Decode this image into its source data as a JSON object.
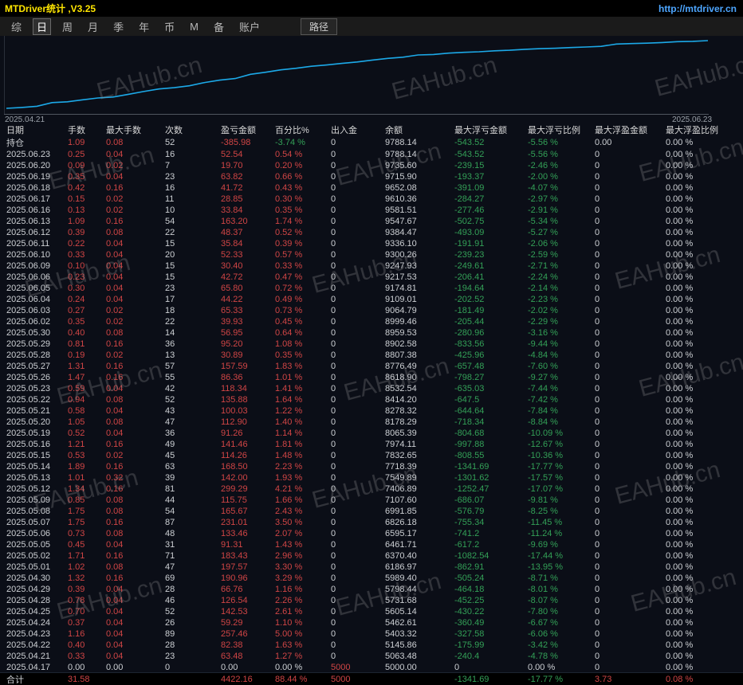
{
  "header": {
    "title": "MTDriver统计 ,V3.25",
    "url": "http://mtdriver.cn"
  },
  "menu": {
    "items": [
      "综",
      "日",
      "周",
      "月",
      "季",
      "年",
      "币",
      "M",
      "备",
      "账户"
    ],
    "selected_index": 1,
    "path_button": "路径"
  },
  "watermark": {
    "text": "EAHub.cn"
  },
  "colors": {
    "red": "#d04545",
    "green": "#33a057",
    "yellow": "#ffe600",
    "blue": "#4da6ff",
    "line": "#1ca9e8"
  },
  "chart_data": {
    "type": "line",
    "title": "",
    "series_name": "余额",
    "x_start_label": "2025.04.21",
    "x_end_label": "2025.06.23",
    "ylim": [
      5000,
      9800
    ],
    "grid": false,
    "balances": [
      5000.0,
      5063.48,
      5145.86,
      5403.32,
      5462.61,
      5605.14,
      5731.68,
      5798.44,
      5989.4,
      6186.97,
      6370.4,
      6461.71,
      6595.17,
      6826.18,
      6991.85,
      7107.6,
      7406.89,
      7549.89,
      7718.39,
      7832.65,
      7974.11,
      8065.39,
      8178.29,
      8278.32,
      8414.2,
      8532.54,
      8618.9,
      8776.49,
      8807.38,
      8902.58,
      8959.53,
      8999.46,
      9064.79,
      9109.01,
      9174.81,
      9217.53,
      9247.93,
      9300.26,
      9336.1,
      9384.47,
      9547.67,
      9581.51,
      9610.36,
      9652.08,
      9715.9,
      9735.6,
      9788.14
    ]
  },
  "table": {
    "columns": [
      "日期",
      "手数",
      "最大手数",
      "次数",
      "盈亏金额",
      "百分比%",
      "出入金",
      "余额",
      "最大浮亏金额",
      "最大浮亏比例",
      "最大浮盈金额",
      "最大浮盈比例"
    ],
    "rows": [
      [
        "持仓",
        "1.09",
        "0.08",
        "52",
        "-385.98",
        "-3.74 %",
        "0",
        "9788.14",
        "-543.52",
        "-5.56 %",
        "0.00",
        "0.00 %"
      ],
      [
        "2025.06.23",
        "0.25",
        "0.04",
        "16",
        "52.54",
        "0.54 %",
        "0",
        "9788.14",
        "-543.52",
        "-5.56 %",
        "0",
        "0.00 %"
      ],
      [
        "2025.06.20",
        "0.09",
        "0.02",
        "7",
        "19.70",
        "0.20 %",
        "0",
        "9735.60",
        "-239.15",
        "-2.46 %",
        "0",
        "0.00 %"
      ],
      [
        "2025.06.19",
        "0.35",
        "0.04",
        "23",
        "63.82",
        "0.66 %",
        "0",
        "9715.90",
        "-193.37",
        "-2.00 %",
        "0",
        "0.00 %"
      ],
      [
        "2025.06.18",
        "0.42",
        "0.16",
        "16",
        "41.72",
        "0.43 %",
        "0",
        "9652.08",
        "-391.09",
        "-4.07 %",
        "0",
        "0.00 %"
      ],
      [
        "2025.06.17",
        "0.15",
        "0.02",
        "11",
        "28.85",
        "0.30 %",
        "0",
        "9610.36",
        "-284.27",
        "-2.97 %",
        "0",
        "0.00 %"
      ],
      [
        "2025.06.16",
        "0.13",
        "0.02",
        "10",
        "33.84",
        "0.35 %",
        "0",
        "9581.51",
        "-277.46",
        "-2.91 %",
        "0",
        "0.00 %"
      ],
      [
        "2025.06.13",
        "1.09",
        "0.16",
        "54",
        "163.20",
        "1.74 %",
        "0",
        "9547.67",
        "-502.75",
        "-5.34 %",
        "0",
        "0.00 %"
      ],
      [
        "2025.06.12",
        "0.39",
        "0.08",
        "22",
        "48.37",
        "0.52 %",
        "0",
        "9384.47",
        "-493.09",
        "-5.27 %",
        "0",
        "0.00 %"
      ],
      [
        "2025.06.11",
        "0.22",
        "0.04",
        "15",
        "35.84",
        "0.39 %",
        "0",
        "9336.10",
        "-191.91",
        "-2.06 %",
        "0",
        "0.00 %"
      ],
      [
        "2025.06.10",
        "0.33",
        "0.04",
        "20",
        "52.33",
        "0.57 %",
        "0",
        "9300.26",
        "-239.23",
        "-2.59 %",
        "0",
        "0.00 %"
      ],
      [
        "2025.06.09",
        "0.10",
        "0.04",
        "15",
        "30.40",
        "0.33 %",
        "0",
        "9247.93",
        "-249.61",
        "-2.71 %",
        "0",
        "0.00 %"
      ],
      [
        "2025.06.06",
        "0.23",
        "0.04",
        "15",
        "42.72",
        "0.47 %",
        "0",
        "9217.53",
        "-206.41",
        "-2.24 %",
        "0",
        "0.00 %"
      ],
      [
        "2025.06.05",
        "0.30",
        "0.04",
        "23",
        "65.80",
        "0.72 %",
        "0",
        "9174.81",
        "-194.64",
        "-2.14 %",
        "0",
        "0.00 %"
      ],
      [
        "2025.06.04",
        "0.24",
        "0.04",
        "17",
        "44.22",
        "0.49 %",
        "0",
        "9109.01",
        "-202.52",
        "-2.23 %",
        "0",
        "0.00 %"
      ],
      [
        "2025.06.03",
        "0.27",
        "0.02",
        "18",
        "65.33",
        "0.73 %",
        "0",
        "9064.79",
        "-181.49",
        "-2.02 %",
        "0",
        "0.00 %"
      ],
      [
        "2025.06.02",
        "0.35",
        "0.02",
        "22",
        "39.93",
        "0.45 %",
        "0",
        "8999.46",
        "-205.44",
        "-2.29 %",
        "0",
        "0.00 %"
      ],
      [
        "2025.05.30",
        "0.40",
        "0.08",
        "14",
        "56.95",
        "0.64 %",
        "0",
        "8959.53",
        "-280.96",
        "-3.16 %",
        "0",
        "0.00 %"
      ],
      [
        "2025.05.29",
        "0.81",
        "0.16",
        "36",
        "95.20",
        "1.08 %",
        "0",
        "8902.58",
        "-833.56",
        "-9.44 %",
        "0",
        "0.00 %"
      ],
      [
        "2025.05.28",
        "0.19",
        "0.02",
        "13",
        "30.89",
        "0.35 %",
        "0",
        "8807.38",
        "-425.96",
        "-4.84 %",
        "0",
        "0.00 %"
      ],
      [
        "2025.05.27",
        "1.31",
        "0.16",
        "57",
        "157.59",
        "1.83 %",
        "0",
        "8776.49",
        "-657.48",
        "-7.60 %",
        "0",
        "0.00 %"
      ],
      [
        "2025.05.26",
        "1.47",
        "0.16",
        "55",
        "86.36",
        "1.01 %",
        "0",
        "8618.90",
        "-798.27",
        "-9.27 %",
        "0",
        "0.00 %"
      ],
      [
        "2025.05.23",
        "0.59",
        "0.04",
        "42",
        "118.34",
        "1.41 %",
        "0",
        "8532.54",
        "-635.03",
        "-7.44 %",
        "0",
        "0.00 %"
      ],
      [
        "2025.05.22",
        "0.94",
        "0.08",
        "52",
        "135.88",
        "1.64 %",
        "0",
        "8414.20",
        "-647.5",
        "-7.42 %",
        "0",
        "0.00 %"
      ],
      [
        "2025.05.21",
        "0.58",
        "0.04",
        "43",
        "100.03",
        "1.22 %",
        "0",
        "8278.32",
        "-644.64",
        "-7.84 %",
        "0",
        "0.00 %"
      ],
      [
        "2025.05.20",
        "1.05",
        "0.08",
        "47",
        "112.90",
        "1.40 %",
        "0",
        "8178.29",
        "-718.34",
        "-8.84 %",
        "0",
        "0.00 %"
      ],
      [
        "2025.05.19",
        "0.52",
        "0.04",
        "36",
        "91.26",
        "1.14 %",
        "0",
        "8065.39",
        "-804.68",
        "-10.09 %",
        "0",
        "0.00 %"
      ],
      [
        "2025.05.16",
        "1.21",
        "0.16",
        "49",
        "141.46",
        "1.81 %",
        "0",
        "7974.11",
        "-997.88",
        "-12.67 %",
        "0",
        "0.00 %"
      ],
      [
        "2025.05.15",
        "0.53",
        "0.02",
        "45",
        "114.26",
        "1.48 %",
        "0",
        "7832.65",
        "-808.55",
        "-10.36 %",
        "0",
        "0.00 %"
      ],
      [
        "2025.05.14",
        "1.89",
        "0.16",
        "63",
        "168.50",
        "2.23 %",
        "0",
        "7718.39",
        "-1341.69",
        "-17.77 %",
        "0",
        "0.00 %"
      ],
      [
        "2025.05.13",
        "1.01",
        "0.32",
        "39",
        "142.00",
        "1.93 %",
        "0",
        "7549.89",
        "-1301.62",
        "-17.57 %",
        "0",
        "0.00 %"
      ],
      [
        "2025.05.12",
        "1.34",
        "0.16",
        "81",
        "299.29",
        "4.21 %",
        "0",
        "7406.89",
        "-1252.47",
        "-17.07 %",
        "0",
        "0.00 %"
      ],
      [
        "2025.05.09",
        "0.85",
        "0.08",
        "44",
        "115.75",
        "1.66 %",
        "0",
        "7107.60",
        "-686.07",
        "-9.81 %",
        "0",
        "0.00 %"
      ],
      [
        "2025.05.08",
        "1.75",
        "0.08",
        "54",
        "165.67",
        "2.43 %",
        "0",
        "6991.85",
        "-576.79",
        "-8.25 %",
        "0",
        "0.00 %"
      ],
      [
        "2025.05.07",
        "1.75",
        "0.16",
        "87",
        "231.01",
        "3.50 %",
        "0",
        "6826.18",
        "-755.34",
        "-11.45 %",
        "0",
        "0.00 %"
      ],
      [
        "2025.05.06",
        "0.73",
        "0.08",
        "48",
        "133.46",
        "2.07 %",
        "0",
        "6595.17",
        "-741.2",
        "-11.24 %",
        "0",
        "0.00 %"
      ],
      [
        "2025.05.05",
        "0.45",
        "0.04",
        "31",
        "91.31",
        "1.43 %",
        "0",
        "6461.71",
        "-617.2",
        "-9.69 %",
        "0",
        "0.00 %"
      ],
      [
        "2025.05.02",
        "1.71",
        "0.16",
        "71",
        "183.43",
        "2.96 %",
        "0",
        "6370.40",
        "-1082.54",
        "-17.44 %",
        "0",
        "0.00 %"
      ],
      [
        "2025.05.01",
        "1.02",
        "0.08",
        "47",
        "197.57",
        "3.30 %",
        "0",
        "6186.97",
        "-862.91",
        "-13.95 %",
        "0",
        "0.00 %"
      ],
      [
        "2025.04.30",
        "1.32",
        "0.16",
        "69",
        "190.96",
        "3.29 %",
        "0",
        "5989.40",
        "-505.24",
        "-8.71 %",
        "0",
        "0.00 %"
      ],
      [
        "2025.04.29",
        "0.39",
        "0.04",
        "28",
        "66.76",
        "1.16 %",
        "0",
        "5798.44",
        "-464.18",
        "-8.01 %",
        "0",
        "0.00 %"
      ],
      [
        "2025.04.28",
        "0.78",
        "0.04",
        "46",
        "126.54",
        "2.26 %",
        "0",
        "5731.68",
        "-452.25",
        "-8.07 %",
        "0",
        "0.00 %"
      ],
      [
        "2025.04.25",
        "0.70",
        "0.04",
        "52",
        "142.53",
        "2.61 %",
        "0",
        "5605.14",
        "-430.22",
        "-7.80 %",
        "0",
        "0.00 %"
      ],
      [
        "2025.04.24",
        "0.37",
        "0.04",
        "26",
        "59.29",
        "1.10 %",
        "0",
        "5462.61",
        "-360.49",
        "-6.67 %",
        "0",
        "0.00 %"
      ],
      [
        "2025.04.23",
        "1.16",
        "0.04",
        "89",
        "257.46",
        "5.00 %",
        "0",
        "5403.32",
        "-327.58",
        "-6.06 %",
        "0",
        "0.00 %"
      ],
      [
        "2025.04.22",
        "0.40",
        "0.04",
        "28",
        "82.38",
        "1.63 %",
        "0",
        "5145.86",
        "-175.99",
        "-3.42 %",
        "0",
        "0.00 %"
      ],
      [
        "2025.04.21",
        "0.33",
        "0.04",
        "23",
        "63.48",
        "1.27 %",
        "0",
        "5063.48",
        "-240.4",
        "-4.78 %",
        "0",
        "0.00 %"
      ],
      [
        "2025.04.17",
        "0.00",
        "0.00",
        "0",
        "0.00",
        "0.00 %",
        "5000",
        "5000.00",
        "0",
        "0.00 %",
        "0",
        "0.00 %"
      ]
    ],
    "total_row": [
      "合计",
      "31.58",
      "",
      "",
      "4422.16",
      "88.44 %",
      "5000",
      "",
      "-1341.69",
      "-17.77 %",
      "3.73",
      "0.08 %"
    ]
  }
}
